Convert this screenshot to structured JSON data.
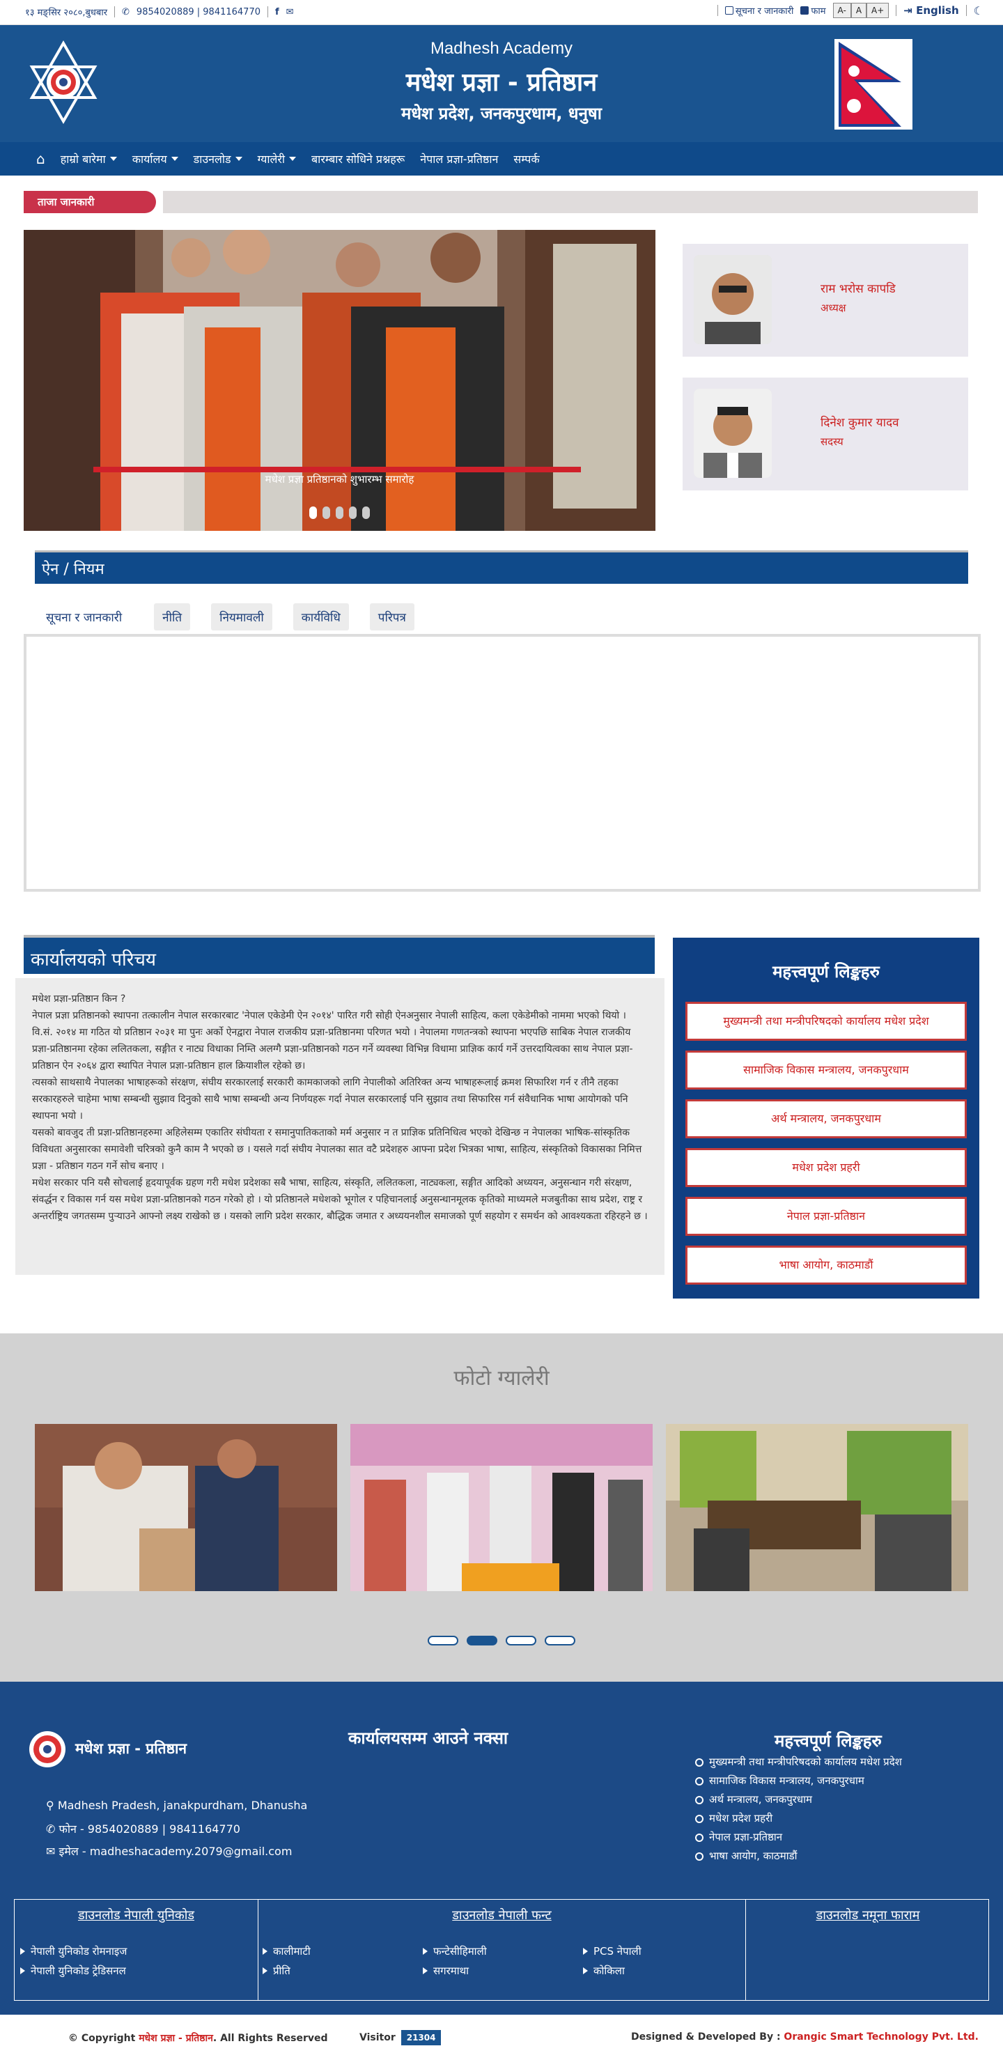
{
  "topbar": {
    "date": "१३ मङ्सिर २०८०,बुधबार",
    "phones": "9854020889 | 9841164770",
    "notice_link": "सूचना र जानकारी",
    "form_link": "फाम",
    "font_small": "A-",
    "font_normal": "A",
    "font_large": "A+",
    "language": "English"
  },
  "header": {
    "title_en": "Madhesh Academy",
    "title_np": "मधेश प्रज्ञा - प्रतिष्ठान",
    "address": "मधेश प्रदेश, जनकपुरधाम, धनुषा"
  },
  "nav": {
    "items": [
      {
        "label": "हाम्रो बारेमा",
        "dropdown": true
      },
      {
        "label": "कार्यालय",
        "dropdown": true
      },
      {
        "label": "डाउनलोड",
        "dropdown": true
      },
      {
        "label": "ग्यालेरी",
        "dropdown": true
      },
      {
        "label": "बारम्बार सोधिने प्रश्नहरू",
        "dropdown": false
      },
      {
        "label": "नेपाल प्रज्ञा-प्रतिष्ठान",
        "dropdown": false
      },
      {
        "label": "सम्पर्क",
        "dropdown": false
      }
    ]
  },
  "ticker": {
    "label": "ताजा जानकारी"
  },
  "slider": {
    "caption": "मधेश प्रज्ञा प्रतिष्ठानको शुभारम्भ समारोह",
    "slide_count": 5,
    "active": 0
  },
  "people": [
    {
      "name": "राम भरोस कापडि",
      "role": "अध्यक्ष"
    },
    {
      "name": "दिनेश कुमार यादव",
      "role": "सदस्य"
    }
  ],
  "laws": {
    "heading": "ऐन / नियम",
    "tabs": [
      "सूचना र जानकारी",
      "नीति",
      "नियमावली",
      "कार्यविधि",
      "परिपत्र"
    ]
  },
  "intro": {
    "heading": "कार्यालयको परिचय",
    "paragraphs": [
      "मधेश प्रज्ञा-प्रतिष्ठान किन ?",
      "नेपाल प्रज्ञा प्रतिष्ठानको स्थापना तत्कालीन नेपाल सरकारबाट 'नेपाल एकेडेमी ऐन २०१४' पारित गरी सोही ऐनअनुसार नेपाली साहित्य, कला एकेडेमीको नाममा भएको थियो । वि.सं. २०१४ मा गठित यो प्रतिष्ठान २०३१ मा पुनः अर्को ऐनद्वारा नेपाल राजकीय प्रज्ञा-प्रतिष्ठानमा परिणत भयो । नेपालमा गणतन्त्रको स्थापना भएपछि साबिक नेपाल राजकीय प्रज्ञा-प्रतिष्ठानमा रहेका ललितकला, सङ्गीत र नाट्य विधाका निम्ति अलग्गै प्रज्ञा-प्रतिष्ठानको गठन गर्ने व्यवस्था विभिन्न विधामा प्राज्ञिक कार्य गर्ने उत्तरदायित्वका साथ नेपाल प्रज्ञा-प्रतिष्ठान ऐन २०६४ द्वारा स्थापित नेपाल प्रज्ञा-प्रतिष्ठान हाल क्रियाशील रहेको छ।",
      "त्यसको साथसाथै नेपालका भाषाहरूको संरक्षण, संघीय सरकारलाई सरकारी कामकाजको लागि नेपालीको अतिरिक्त अन्य भाषाहरूलाई क्रमश सिफारिश गर्न र तीनै तहका सरकारहरुले चाहेमा भाषा सम्बन्धी सुझाव दिनुको साथै भाषा सम्बन्धी अन्य निर्णयहरू गर्दा नेपाल सरकारलाई पनि सुझाव तथा सिफारिस गर्न संवैधानिक भाषा आयोगको पनि स्थापना भयो ।",
      "यसको बावजुद ती प्रज्ञा-प्रतिष्ठानहरुमा अहिलेसम्म एकातिर संघीयता र समानुपातिकताको मर्म अनुसार न त प्राज्ञिक प्रतिनिधित्व भएको देखिन्छ न नेपालका भाषिक-सांस्कृतिक विविधता अनुसारका समावेशी चरित्रको कुनै काम नै भएको छ । यसले गर्दा संघीय नेपालका सात वटै प्रदेशहरु आफ्ना प्रदेश भित्रका भाषा, साहित्य, संस्कृतिको विकासका निमित्त प्रज्ञा - प्रतिष्ठान गठन गर्ने सोच बनाए ।",
      "मधेश सरकार पनि यसै सोचलाई हृदयापूर्वक ग्रहण गरी मधेश प्रदेशका सबै भाषा, साहित्य, संस्कृति, ललितकला, नाट्यकला, सङ्गीत आदिको अध्ययन, अनुसन्धान गरी संरक्षण, संवर्द्धन र विकास गर्न यस मधेश प्रज्ञा-प्रतिष्ठानको गठन गरेको हो । यो प्रतिष्ठानले मधेशको भूगोल र पहिचानलाई अनुसन्धानमूलक कृतिको माध्यमले मजबुतीका साथ प्रदेश, राष्ट्र र अन्तर्राष्ट्रिय जगतसम्म पुऱ्याउने आफ्नो लक्ष्य राखेको छ । यसको लागि प्रदेश सरकार, बौद्धिक जमात र अध्ययनशील समाजको पूर्ण सहयोग र समर्थन को आवश्यकता रहिरहने छ ।"
    ]
  },
  "important_links": {
    "title": "महत्त्वपूर्ण लिङ्कहरु",
    "items": [
      "मुख्यमन्त्री तथा मन्त्रीपरिषदको कार्यालय मधेश प्रदेश",
      "सामाजिक विकास मन्त्रालय, जनकपुरधाम",
      "अर्थ मन्त्रालय, जनकपुरधाम",
      "मधेश प्रदेश प्रहरी",
      "नेपाल प्रज्ञा-प्रतिष्ठान",
      "भाषा आयोग, काठमाडौं"
    ]
  },
  "gallery": {
    "title": "फोटो ग्यालेरी",
    "page_count": 4,
    "active": 1
  },
  "footer": {
    "org_name": "मधेश प्रज्ञा - प्रतिष्ठान",
    "map_title": "कार्यालयसम्म आउने नक्सा",
    "address": "Madhesh Pradesh, janakpurdham, Dhanusha",
    "phone": "फोन - 9854020889 | 9841164770",
    "email": "इमेल - madheshacademy.2079@gmail.com",
    "links_title": "महत्त्वपूर्ण लिङ्कहरु",
    "links": [
      "मुख्यमन्त्री तथा मन्त्रीपरिषदको कार्यालय मधेश प्रदेश",
      "सामाजिक विकास मन्त्रालय, जनकपुरधाम",
      "अर्थ मन्त्रालय, जनकपुरधाम",
      "मधेश प्रदेश प्रहरी",
      "नेपाल प्रज्ञा-प्रतिष्ठान",
      "भाषा आयोग, काठमाडौं"
    ],
    "dl_unicode_title": "डाउनलोड नेपाली युनिकोड",
    "dl_unicode_items": [
      "नेपाली युनिकोड रोमनाइज",
      "नेपाली युनिकोड ट्रेडिसनल"
    ],
    "dl_font_title": "डाउनलोड नेपाली फन्ट",
    "dl_font_items": [
      "कालीमाटी",
      "प्रीति",
      "फन्टेसीहिमाली",
      "सगरमाथा",
      "PCS नेपाली",
      "कोकिला"
    ],
    "dl_form_title": "डाउनलोड नमूना फाराम"
  },
  "bottom": {
    "copyright_prefix": "© Copyright",
    "copyright_name": "मधेश प्रज्ञा - प्रतिष्ठान",
    "copyright_suffix": ". All Rights Reserved",
    "visitor_label": "Visitor",
    "visitor_count": "21304",
    "designed_by_label": "Designed & Developed By :",
    "designed_by_name": "Orangic Smart Technology Pvt. Ltd."
  },
  "colors": {
    "primary": "#1a5490",
    "nav": "#0f4a8a",
    "accent_red": "#c9324a",
    "footer": "#1c4a86"
  },
  "icons": [
    "phone-icon",
    "facebook-icon",
    "mail-icon",
    "document-icon",
    "form-icon",
    "login-icon",
    "moon-icon",
    "home-icon",
    "map-pin-icon",
    "gear-icon"
  ]
}
